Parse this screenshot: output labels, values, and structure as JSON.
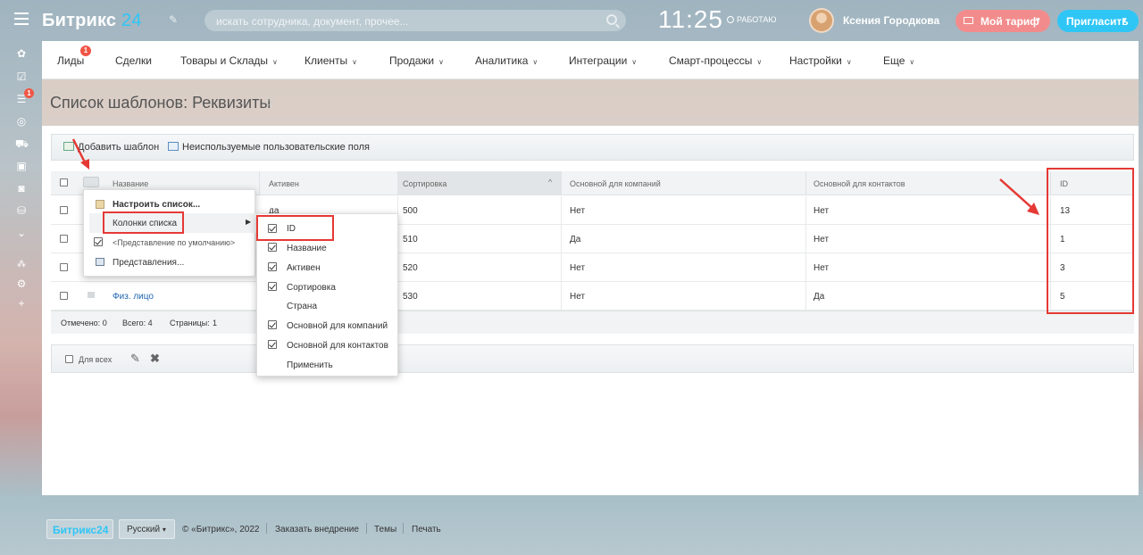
{
  "header": {
    "logo_main": "Битрикс",
    "logo_num": "24",
    "search_placeholder": "искать сотрудника, документ, прочее...",
    "clock": "11:25",
    "work_status": "РАБОТАЮ",
    "user_name": "Ксения Городкова",
    "tariff_label": "Мой тариф",
    "invite_label": "Пригласить"
  },
  "rail": {
    "badge": "1",
    "icons": [
      "feed-icon",
      "tasks-icon",
      "crm-icon",
      "goal-icon",
      "shop-icon",
      "contacts-icon",
      "robot-icon",
      "storage-icon",
      "more-icon",
      "structure-icon",
      "settings-icon",
      "add-icon"
    ]
  },
  "menu": {
    "items": [
      "Лиды",
      "Сделки",
      "Товары и Склады",
      "Клиенты",
      "Продажи",
      "Аналитика",
      "Интеграции",
      "Смарт-процессы",
      "Настройки",
      "Еще"
    ],
    "leads_badge": "1"
  },
  "page": {
    "title": "Список шаблонов: Реквизиты"
  },
  "toolbar": {
    "add_template": "Добавить шаблон",
    "unused_fields": "Неиспользуемые пользовательские поля"
  },
  "grid": {
    "columns": [
      "Название",
      "Активен",
      "Сортировка",
      "Основной для компаний",
      "Основной для контактов",
      "ID"
    ],
    "rows": [
      {
        "name": "",
        "active": "да",
        "sort": "500",
        "company": "Нет",
        "contact": "Нет",
        "id": "13"
      },
      {
        "name": "",
        "active": "",
        "sort": "510",
        "company": "Да",
        "contact": "Нет",
        "id": "1"
      },
      {
        "name": "",
        "active": "",
        "sort": "520",
        "company": "Нет",
        "contact": "Нет",
        "id": "3"
      },
      {
        "name": "Физ. лицо",
        "active": "",
        "sort": "530",
        "company": "Нет",
        "contact": "Да",
        "id": "5"
      }
    ],
    "footer": {
      "marked": "Отмечено: 0",
      "total": "Всего: 4",
      "pages": "Страницы:",
      "page_num": "1"
    },
    "for_all": "Для всех"
  },
  "settings_menu": {
    "configure": "Настроить список...",
    "columns": "Колонки списка",
    "default_view": "<Представление по умолчанию>",
    "views": "Представления..."
  },
  "columns_menu": {
    "items": [
      {
        "label": "ID",
        "checked": true
      },
      {
        "label": "Название",
        "checked": true
      },
      {
        "label": "Активен",
        "checked": true
      },
      {
        "label": "Сортировка",
        "checked": true
      },
      {
        "label": "Страна",
        "checked": false
      },
      {
        "label": "Основной для компаний",
        "checked": true
      },
      {
        "label": "Основной для контактов",
        "checked": true
      }
    ],
    "apply": "Применить"
  },
  "footer": {
    "logo": "Битрикс24",
    "lang": "Русский",
    "copyright": "© «Битрикс», 2022",
    "order": "Заказать внедрение",
    "themes": "Темы",
    "print": "Печать"
  },
  "colors": {
    "accent": "#2fc6f6",
    "badge": "#f05545",
    "tariff": "#f28c8c",
    "highlight": "#e53935"
  }
}
